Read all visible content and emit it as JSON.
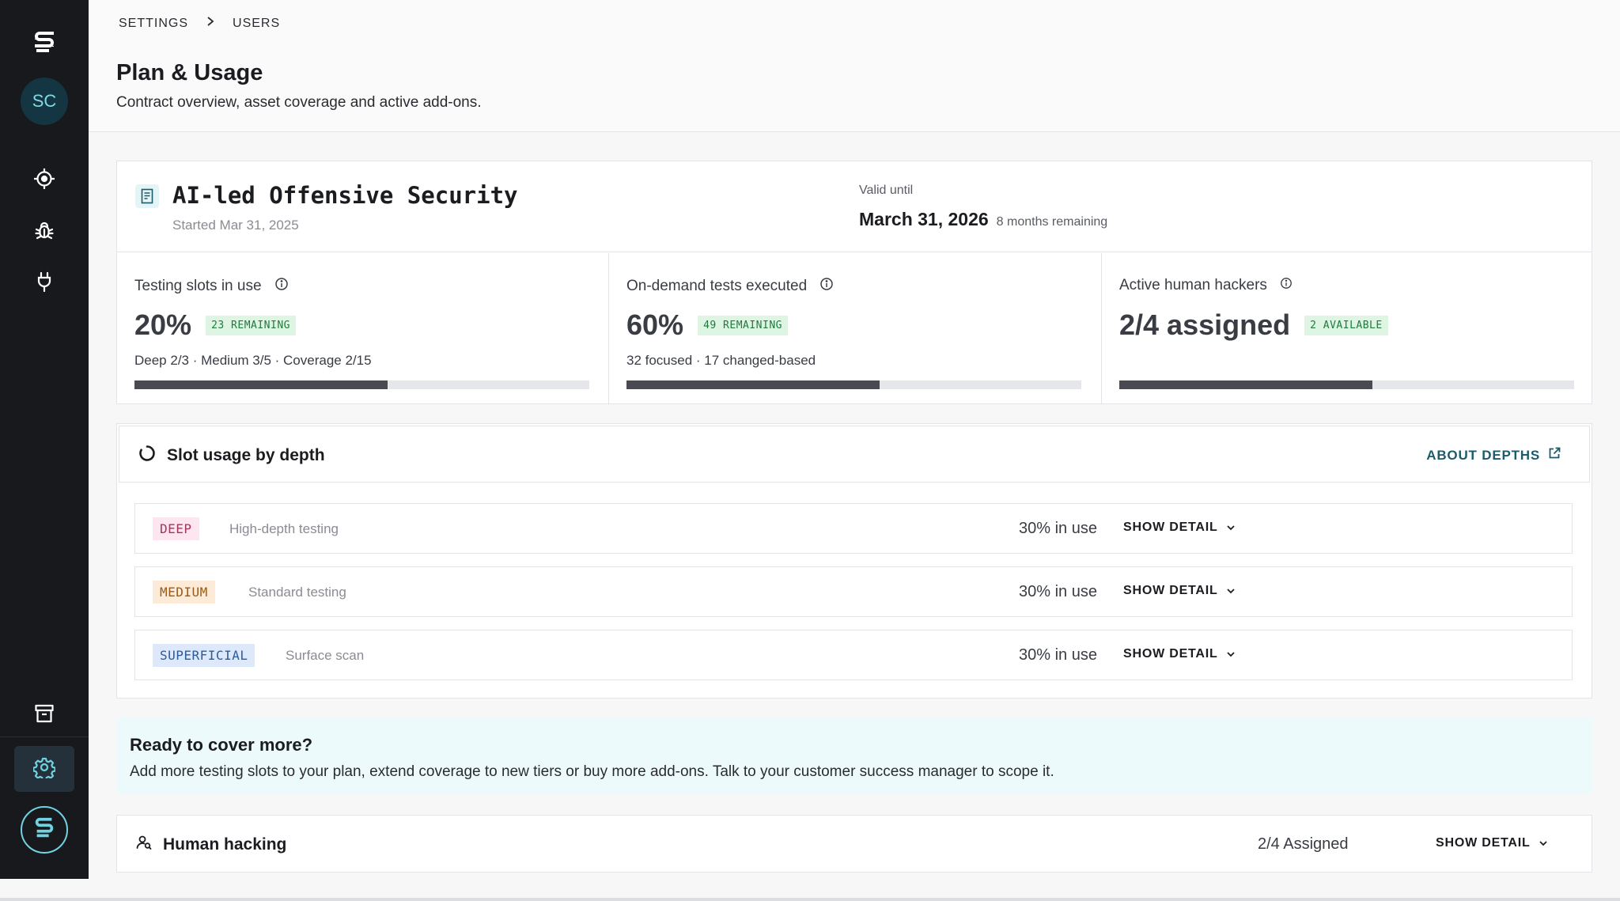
{
  "colors": {
    "sidebar_bg": "#18191d",
    "accent": "#6fd3e2",
    "badge_green_bg": "#def5e4",
    "badge_green_text": "#1f7a3d",
    "progress_fill": "#4a4b52",
    "cta_bg": "#edfafc"
  },
  "sidebar": {
    "logo_icon": "brand-s-icon",
    "avatar_initials": "SC",
    "nav": [
      {
        "name": "target",
        "icon": "crosshair-icon"
      },
      {
        "name": "bugs",
        "icon": "bug-icon"
      },
      {
        "name": "integrations",
        "icon": "plug-icon"
      },
      {
        "name": "archive",
        "icon": "archive-icon"
      },
      {
        "name": "settings",
        "icon": "gear-icon",
        "active": true
      }
    ]
  },
  "breadcrumb": {
    "items": [
      "SETTINGS",
      "USERS"
    ]
  },
  "header": {
    "title": "Plan & Usage",
    "subtitle": "Contract overview, asset coverage and active add-ons."
  },
  "plan": {
    "name": "AI-led Offensive Security",
    "started": "Started Mar 31, 2025",
    "valid_label": "Valid until",
    "valid_date": "March 31, 2026",
    "remaining": "8 months remaining"
  },
  "metrics": [
    {
      "label": "Testing slots in use",
      "value": "20%",
      "badge": "23 REMAINING",
      "detail": "Deep 2/3 · Medium 3/5 · Coverage 2/15",
      "progress": 0.556
    },
    {
      "label": "On-demand tests executed",
      "value": "60%",
      "badge": "49 REMAINING",
      "detail": "32 focused · 17 changed-based",
      "progress": 0.556
    },
    {
      "label": "Active human hackers",
      "value": "2/4 assigned",
      "badge": "2 AVAILABLE",
      "detail": "",
      "progress": 0.556
    }
  ],
  "depth": {
    "title": "Slot usage by depth",
    "about_link": "ABOUT DEPTHS",
    "rows": [
      {
        "tag": "DEEP",
        "description": "High-depth testing",
        "usage": "30% in use",
        "action": "SHOW DETAIL",
        "tag_bg": "#fde6f0",
        "tag_color": "#a8325e"
      },
      {
        "tag": "MEDIUM",
        "description": "Standard testing",
        "usage": "30% in use",
        "action": "SHOW DETAIL",
        "tag_bg": "#fdebd8",
        "tag_color": "#9a5a14"
      },
      {
        "tag": "SUPERFICIAL",
        "description": "Surface scan",
        "usage": "30% in use",
        "action": "SHOW DETAIL",
        "tag_bg": "#dde9fb",
        "tag_color": "#2d5a9a"
      }
    ]
  },
  "cta": {
    "title": "Ready to cover more?",
    "text": "Add more testing slots to your plan, extend coverage to new tiers or buy more add-ons. Talk to your customer success manager to scope it."
  },
  "human_hacking": {
    "title": "Human hacking",
    "usage": "2/4 Assigned",
    "action": "SHOW DETAIL"
  }
}
